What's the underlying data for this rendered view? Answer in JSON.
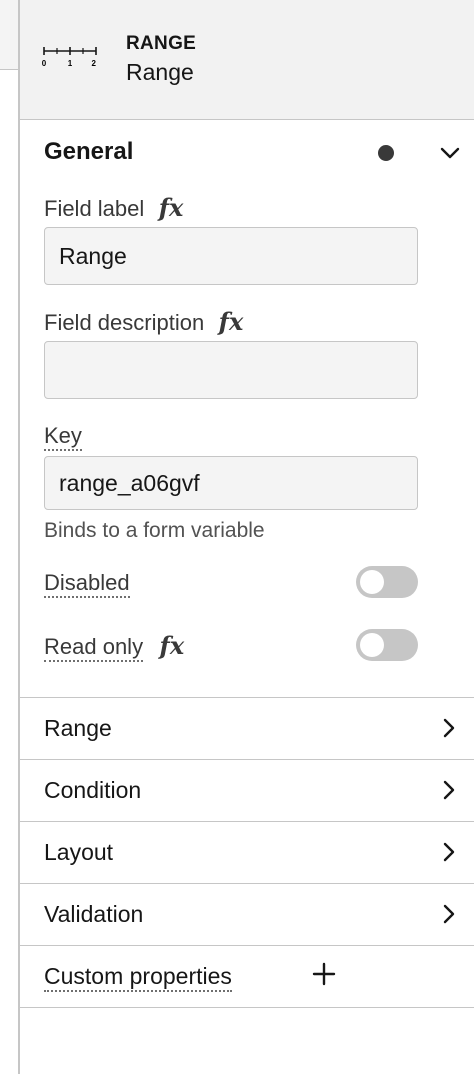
{
  "header": {
    "type_label": "RANGE",
    "field_name": "Range",
    "type_icon": "range-ruler-icon",
    "icon_ticks": [
      "0",
      "1",
      "2"
    ]
  },
  "general": {
    "title": "General",
    "field_label": {
      "label": "Field label",
      "value": "Range"
    },
    "field_description": {
      "label": "Field description",
      "value": ""
    },
    "key": {
      "label": "Key",
      "value": "range_a06gvf",
      "helper": "Binds to a form variable"
    },
    "disabled": {
      "label": "Disabled",
      "on": false
    },
    "read_only": {
      "label": "Read only",
      "on": false
    },
    "fx_label": "fx"
  },
  "sections": [
    {
      "label": "Range"
    },
    {
      "label": "Condition"
    },
    {
      "label": "Layout"
    },
    {
      "label": "Validation"
    }
  ],
  "custom_properties": {
    "label": "Custom properties"
  },
  "colors": {
    "toggle_off": "#c6c6c6",
    "text_primary": "#161616",
    "header_bg": "#f2f2f2"
  }
}
